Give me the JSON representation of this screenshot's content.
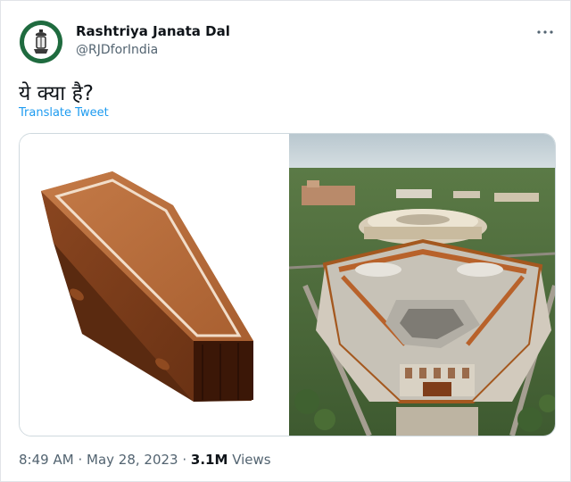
{
  "author": {
    "name": "Rashtriya Janata Dal",
    "handle": "@RJDforIndia"
  },
  "tweet": {
    "text": "ये क्या है?",
    "translate_label": "Translate Tweet"
  },
  "media": {
    "left_icon": "coffin-emoji",
    "right_image": "aerial-photo-parliament-building"
  },
  "meta": {
    "time": "8:49 AM",
    "separator": "·",
    "date": "May 28, 2023",
    "views_count": "3.1M",
    "views_label": "Views"
  },
  "icons": {
    "more": "more-icon",
    "avatar_logo": "lantern-logo"
  },
  "colors": {
    "link": "#1d9bf0",
    "secondary_text": "#536471",
    "avatar_ring": "#1f6b3f"
  }
}
